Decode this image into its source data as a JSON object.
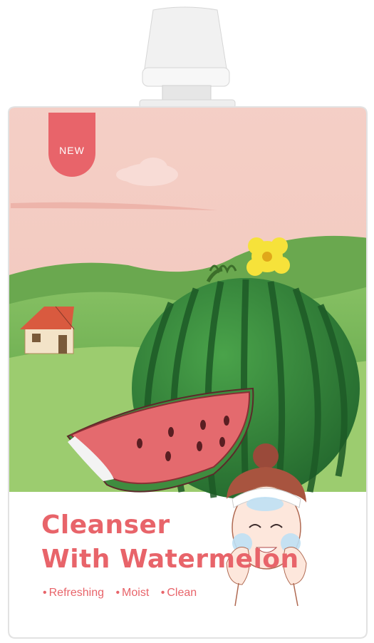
{
  "product": {
    "badge": "NEW",
    "title_line1": "Cleanser",
    "title_line2": "With Watermelon",
    "features": [
      "Refreshing",
      "Moist",
      "Clean"
    ]
  },
  "colors": {
    "sky": "#f3c8c0",
    "accent": "#e8646a",
    "hills": "#7ab55a",
    "watermelon_dark": "#2f7d3a",
    "flesh": "#e46a6e",
    "cap": "#f2f2f2"
  }
}
